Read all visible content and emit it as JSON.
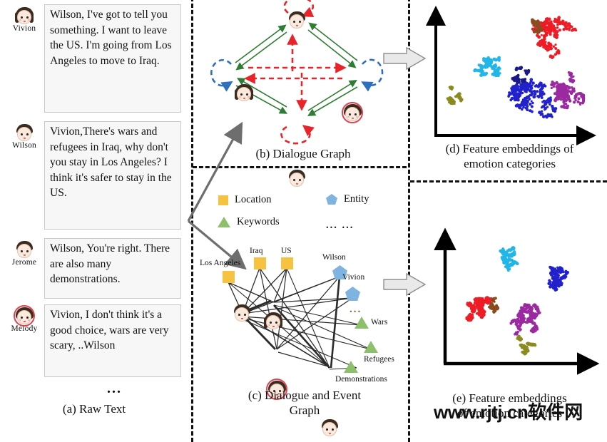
{
  "figure": {
    "watermark": "www.rjtj.cn软件网"
  },
  "panel_a": {
    "caption": "(a) Raw Text",
    "ellipsis": "...",
    "messages": [
      {
        "speaker": "Vivion",
        "avatar": "female-avatar",
        "text": "Wilson, I've got to tell you something.  I want to leave the US. I'm going from Los Angeles to move to Iraq."
      },
      {
        "speaker": "Wilson",
        "avatar": "male-avatar",
        "text": "Vivion,There's wars and refugees in Iraq, why don't you stay in Los Angeles? I think it's safer to stay in the US."
      },
      {
        "speaker": "Jerome",
        "avatar": "male-avatar",
        "text": "Wilson, You're right. There are also many demonstrations."
      },
      {
        "speaker": "Melody",
        "avatar": "female-avatar-ring",
        "text": "Vivion, I don't think it's a good choice, wars are very scary, ..Wilson"
      }
    ]
  },
  "panel_b": {
    "caption": "(b) Dialogue Graph",
    "nodes": [
      {
        "id": "top",
        "avatar": "male-avatar"
      },
      {
        "id": "left",
        "avatar": "female-avatar"
      },
      {
        "id": "right",
        "avatar": "female-avatar-ring"
      },
      {
        "id": "bottom",
        "avatar": "male-avatar"
      }
    ],
    "edge_colors": {
      "inter_speaker": "#2e7d32",
      "intra_speaker": "#e8232a",
      "self_loop_blue": "#2f6fc0",
      "self_loop_red": "#e8232a"
    }
  },
  "panel_c": {
    "caption_line1": "(c) Dialogue and Event",
    "caption_line2": "Graph",
    "legend": [
      {
        "shape": "square",
        "label": "Location",
        "color": "#f5c242"
      },
      {
        "shape": "pentagon",
        "label": "Entity",
        "color": "#7fb4e0"
      },
      {
        "shape": "triangle",
        "label": "Keywords",
        "color": "#8cc06a"
      },
      {
        "shape": "none",
        "label": "...  ...",
        "color": "#333333"
      }
    ],
    "nodes": [
      {
        "label": "Iraq",
        "type": "Location"
      },
      {
        "label": "US",
        "type": "Location"
      },
      {
        "label": "Los Angeles",
        "type": "Location"
      },
      {
        "label": "Wilson",
        "type": "Entity"
      },
      {
        "label": "Vivion",
        "type": "Entity"
      },
      {
        "label": "Wars",
        "type": "Keywords"
      },
      {
        "label": "Refugees",
        "type": "Keywords"
      },
      {
        "label": "Demonstrations",
        "type": "Keywords"
      },
      {
        "label": "...",
        "type": "Ellipsis"
      }
    ]
  },
  "panel_d": {
    "caption_line1": "(d) Feature embeddings of",
    "caption_line2": "emotion categories"
  },
  "panel_e": {
    "caption_line1": "(e) Feature embeddings",
    "caption_line2": "of emotion categories"
  },
  "chart_data": [
    {
      "type": "scatter",
      "id": "panel-d-scatter",
      "title": "(d) Feature embeddings of emotion categories",
      "xlabel": "",
      "ylabel": "",
      "grid": false,
      "legend_position": "none",
      "note": "t-SNE style 2D embedding, 7 emotion-category clusters, axes unlabeled with arrow heads",
      "clusters": [
        {
          "name": "red",
          "color": "#ee1c25",
          "center": [
            0.78,
            0.82
          ],
          "n": 260,
          "spread": 0.1
        },
        {
          "name": "cyan",
          "color": "#22b6e8",
          "center": [
            0.36,
            0.57
          ],
          "n": 180,
          "spread": 0.07
        },
        {
          "name": "blue",
          "color": "#2222cc",
          "center": [
            0.62,
            0.28
          ],
          "n": 300,
          "spread": 0.11
        },
        {
          "name": "purple",
          "color": "#9b29a0",
          "center": [
            0.86,
            0.32
          ],
          "n": 230,
          "spread": 0.09
        },
        {
          "name": "olive",
          "color": "#8a8a1f",
          "center": [
            0.12,
            0.3
          ],
          "n": 70,
          "spread": 0.05
        },
        {
          "name": "brown",
          "color": "#8a4b1f",
          "center": [
            0.7,
            0.86
          ],
          "n": 60,
          "spread": 0.06
        },
        {
          "name": "dark-blue",
          "color": "#1a1a8c",
          "center": [
            0.55,
            0.45
          ],
          "n": 80,
          "spread": 0.06
        }
      ]
    },
    {
      "type": "scatter",
      "id": "panel-e-scatter",
      "title": "(e) Feature embeddings of emotion categories",
      "xlabel": "",
      "ylabel": "",
      "grid": false,
      "legend_position": "none",
      "note": "t-SNE style 2D embedding after training, clusters are tighter and better separated",
      "clusters": [
        {
          "name": "cyan",
          "color": "#22b6e8",
          "center": [
            0.44,
            0.84
          ],
          "n": 160,
          "spread": 0.055
        },
        {
          "name": "blue",
          "color": "#2222cc",
          "center": [
            0.8,
            0.68
          ],
          "n": 200,
          "spread": 0.065
        },
        {
          "name": "red",
          "color": "#ee1c25",
          "center": [
            0.2,
            0.4
          ],
          "n": 230,
          "spread": 0.075
        },
        {
          "name": "brown",
          "color": "#8a4b1f",
          "center": [
            0.33,
            0.43
          ],
          "n": 70,
          "spread": 0.045
        },
        {
          "name": "purple",
          "color": "#9b29a0",
          "center": [
            0.58,
            0.35
          ],
          "n": 260,
          "spread": 0.085
        },
        {
          "name": "olive",
          "color": "#8a8a1f",
          "center": [
            0.58,
            0.12
          ],
          "n": 90,
          "spread": 0.05
        }
      ]
    }
  ]
}
